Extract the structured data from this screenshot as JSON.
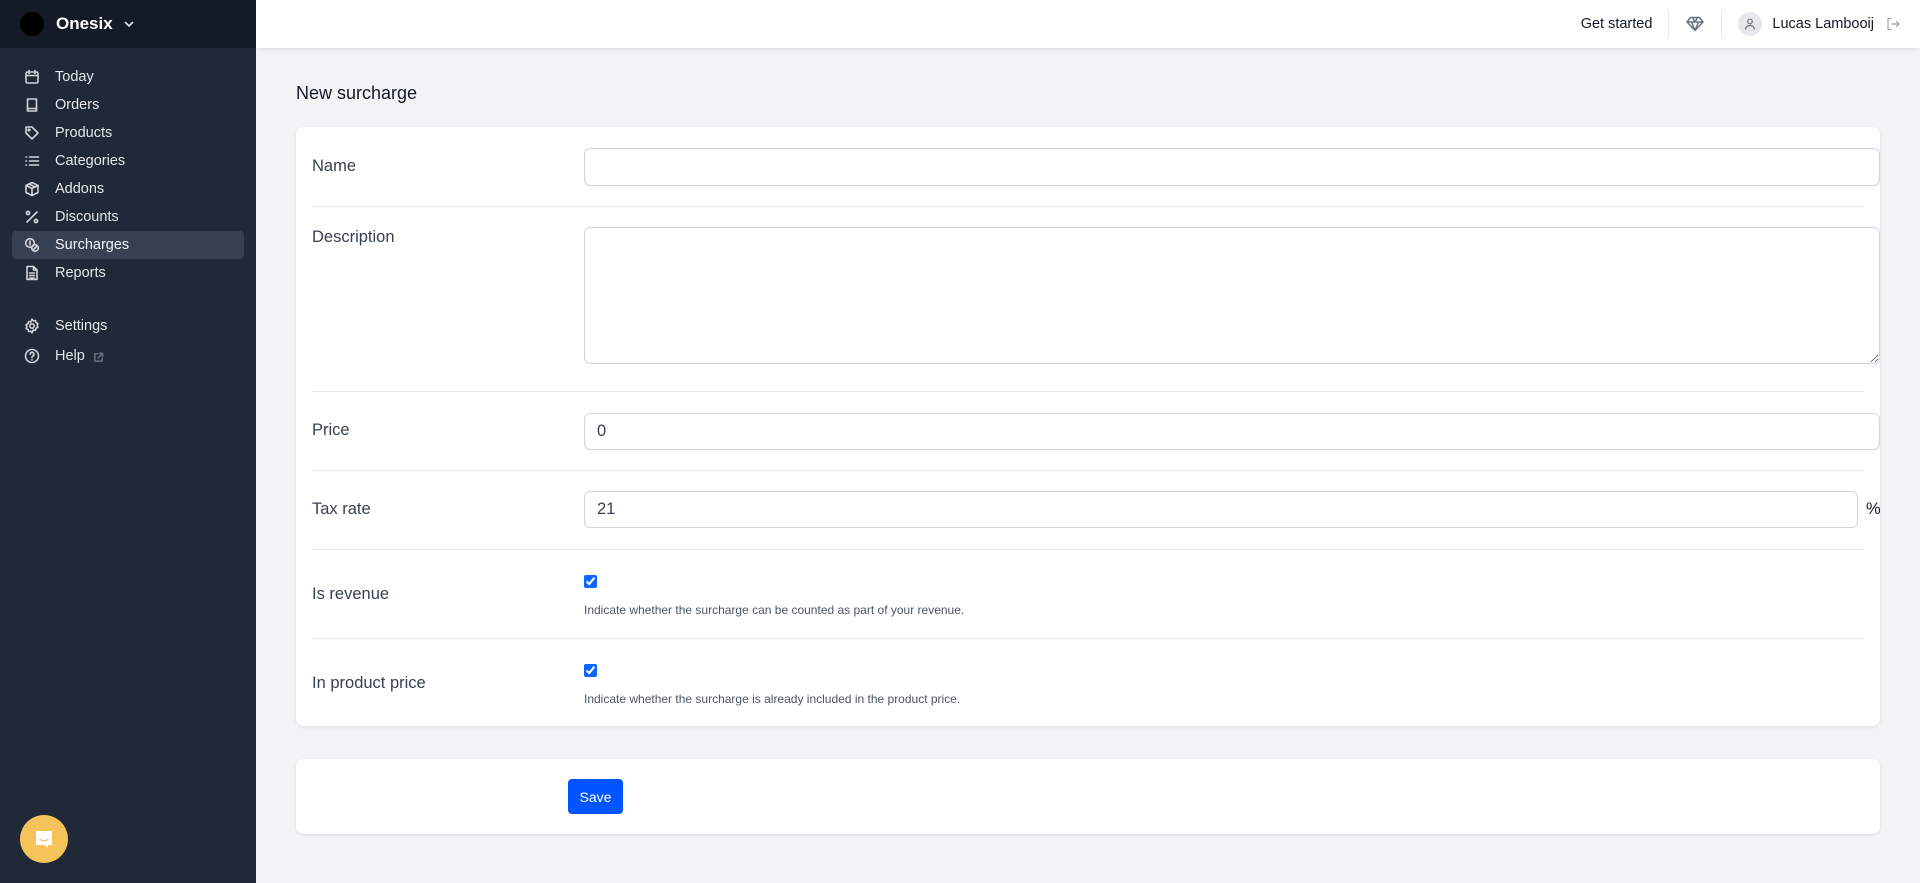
{
  "brand": {
    "name": "Onesix"
  },
  "sidebar": {
    "items": [
      {
        "label": "Today",
        "icon": "calendar-icon",
        "active": false
      },
      {
        "label": "Orders",
        "icon": "book-icon",
        "active": false
      },
      {
        "label": "Products",
        "icon": "tag-icon",
        "active": false
      },
      {
        "label": "Categories",
        "icon": "list-icon",
        "active": false
      },
      {
        "label": "Addons",
        "icon": "cube-icon",
        "active": false
      },
      {
        "label": "Discounts",
        "icon": "percent-icon",
        "active": false
      },
      {
        "label": "Surcharges",
        "icon": "coins-icon",
        "active": true
      },
      {
        "label": "Reports",
        "icon": "document-icon",
        "active": false
      }
    ],
    "secondary": [
      {
        "label": "Settings",
        "icon": "gear-icon"
      },
      {
        "label": "Help",
        "icon": "help-circle-icon",
        "external": true
      }
    ]
  },
  "header": {
    "get_started": "Get started",
    "user_name": "Lucas Lambooij"
  },
  "page": {
    "title": "New surcharge"
  },
  "form": {
    "name": {
      "label": "Name",
      "value": "",
      "placeholder": ""
    },
    "description": {
      "label": "Description",
      "value": "",
      "placeholder": ""
    },
    "price": {
      "label": "Price",
      "value": "0"
    },
    "tax_rate": {
      "label": "Tax rate",
      "value": "21",
      "suffix": "%"
    },
    "is_revenue": {
      "label": "Is revenue",
      "checked": true,
      "help": "Indicate whether the surcharge can be counted as part of your revenue."
    },
    "in_product_price": {
      "label": "In product price",
      "checked": true,
      "help": "Indicate whether the surcharge is already included in the product price."
    }
  },
  "actions": {
    "save_label": "Save"
  },
  "colors": {
    "primary": "#0055ff",
    "sidebar_bg": "#1f2937",
    "sidebar_brand_bg": "#141a28",
    "chat_bubble": "#f6c35b"
  }
}
